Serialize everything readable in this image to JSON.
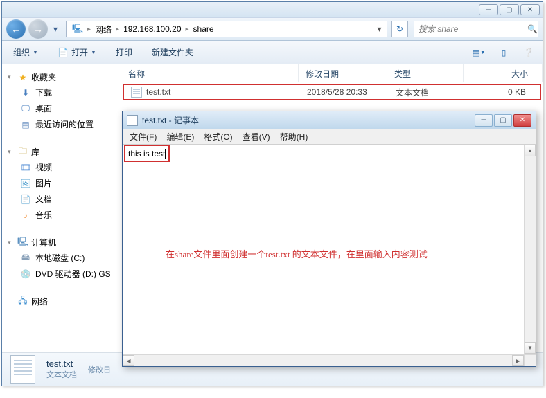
{
  "explorer": {
    "breadcrumb": {
      "root": "网络",
      "host": "192.168.100.20",
      "folder": "share"
    },
    "search_placeholder": "搜索 share",
    "toolbar": {
      "organize": "组织",
      "open": "打开",
      "print": "打印",
      "newfolder": "新建文件夹"
    },
    "columns": {
      "name": "名称",
      "date": "修改日期",
      "type": "类型",
      "size": "大小"
    },
    "files": [
      {
        "name": "test.txt",
        "date": "2018/5/28 20:33",
        "type": "文本文档",
        "size": "0 KB"
      }
    ],
    "details": {
      "name": "test.txt",
      "type": "文本文档",
      "mod_label": "修改日"
    }
  },
  "navpane": {
    "favorites": {
      "label": "收藏夹",
      "items": [
        "下载",
        "桌面",
        "最近访问的位置"
      ]
    },
    "libraries": {
      "label": "库",
      "items": [
        "视频",
        "图片",
        "文档",
        "音乐"
      ]
    },
    "computer": {
      "label": "计算机",
      "items": [
        "本地磁盘 (C:)",
        "DVD 驱动器 (D:) GS"
      ]
    },
    "network": {
      "label": "网络"
    }
  },
  "notepad": {
    "title": "test.txt - 记事本",
    "menu": [
      "文件(F)",
      "编辑(E)",
      "格式(O)",
      "查看(V)",
      "帮助(H)"
    ],
    "content": "this is test",
    "annotation": "在share文件里面创建一个test.txt 的文本文件，在里面输入内容测试"
  }
}
